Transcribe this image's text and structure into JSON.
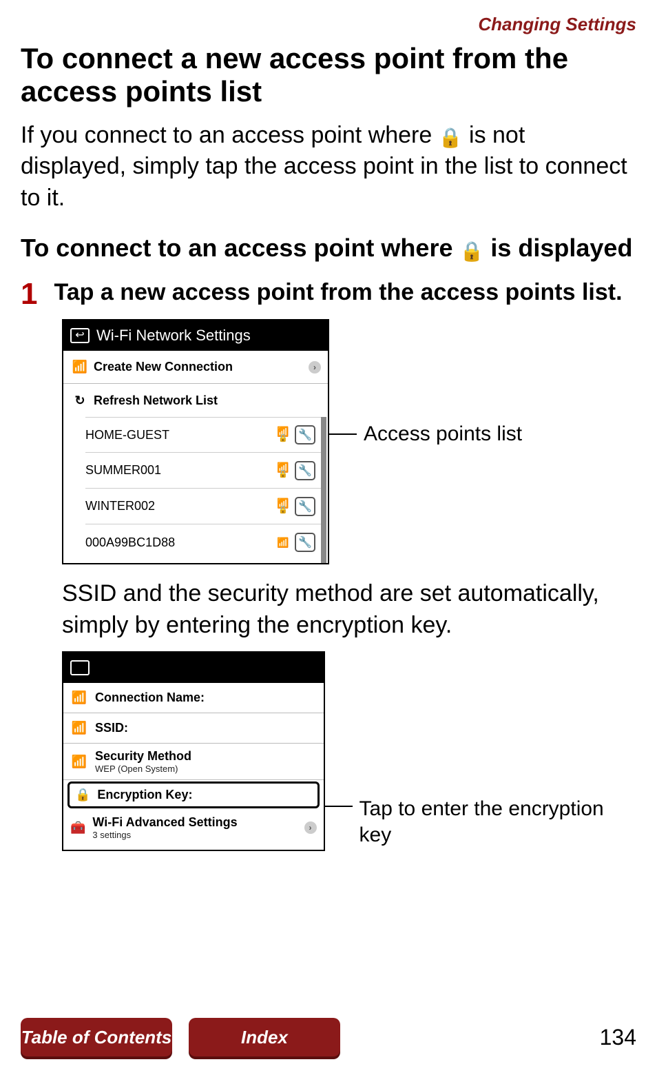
{
  "header": {
    "section": "Changing Settings"
  },
  "h1": "To connect a new access point from the access points list",
  "intro": {
    "before": "If you connect to an access point where ",
    "after": " is not displayed, simply tap the access point in the list to connect to it."
  },
  "h2": {
    "before": "To connect to an access point where ",
    "after": " is displayed"
  },
  "step1": {
    "num": "1",
    "text": "Tap a new access point from the access points list."
  },
  "screenshot1": {
    "title": "Wi-Fi Network Settings",
    "create": "Create New Connection",
    "refresh": "Refresh Network List",
    "networks": [
      {
        "ssid": "HOME-GUEST",
        "locked": true
      },
      {
        "ssid": "SUMMER001",
        "locked": true
      },
      {
        "ssid": "WINTER002",
        "locked": true
      },
      {
        "ssid": "000A99BC1D88",
        "locked": false
      }
    ],
    "callout": "Access points list"
  },
  "body2": "SSID and the security method are set automatically, simply by entering the encryption key.",
  "screenshot2": {
    "conn_name": "Connection Name:",
    "ssid": "SSID:",
    "sec_method": "Security Method",
    "sec_sub": "WEP (Open System)",
    "enc_key": "Encryption Key:",
    "adv": "Wi-Fi Advanced Settings",
    "adv_sub": "3 settings",
    "callout": "Tap to enter the encryption key"
  },
  "footer": {
    "toc": "Table of Contents",
    "index": "Index",
    "page": "134"
  },
  "icons": {
    "lock": "🔒",
    "back": "↩",
    "refresh": "↻",
    "wrench": "🔧",
    "wifi": "📶",
    "chevron": "›",
    "toolbox": "🧰"
  }
}
